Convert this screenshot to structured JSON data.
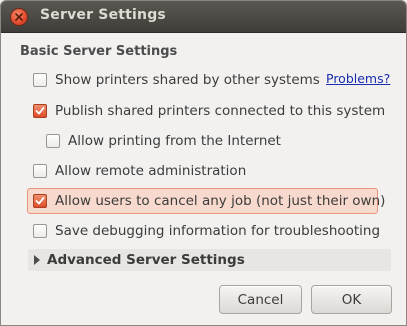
{
  "window": {
    "title": "Server Settings"
  },
  "section": {
    "title": "Basic Server Settings"
  },
  "options": [
    {
      "label": "Show printers shared by other systems",
      "checked": false
    },
    {
      "label": "Publish shared printers connected to this system",
      "checked": true
    },
    {
      "label": "Allow printing from the Internet",
      "checked": false
    },
    {
      "label": "Allow remote administration",
      "checked": false
    },
    {
      "label": "Allow users to cancel any job (not just their own)",
      "checked": true
    },
    {
      "label": "Save debugging information for troubleshooting",
      "checked": false
    }
  ],
  "problems_link": "Problems?",
  "advanced": {
    "label": "Advanced Server Settings",
    "expanded": false
  },
  "buttons": {
    "cancel": "Cancel",
    "ok": "OK"
  },
  "colors": {
    "accent": "#dd4d2a",
    "focus_bg": "#f8d9cd",
    "link": "#1a2fb0"
  }
}
